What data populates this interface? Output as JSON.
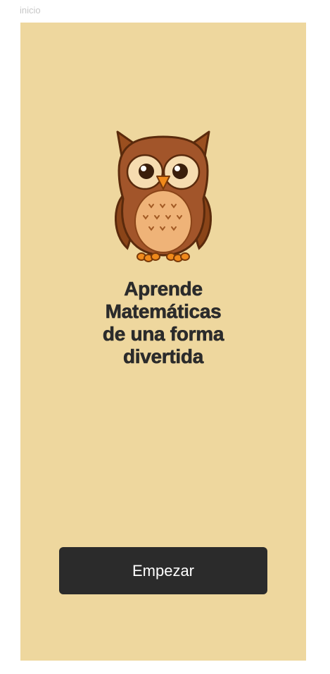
{
  "page": {
    "label": "inicio"
  },
  "hero": {
    "mascot_icon": "owl-icon",
    "headline_lines": [
      "Aprende",
      "Matemáticas",
      "de una forma",
      "divertida"
    ]
  },
  "actions": {
    "start_label": "Empezar"
  },
  "colors": {
    "screen_background": "#eed79e",
    "button_background": "#2b2b2b",
    "button_text": "#ffffff",
    "headline_text": "#2b2b2b"
  }
}
